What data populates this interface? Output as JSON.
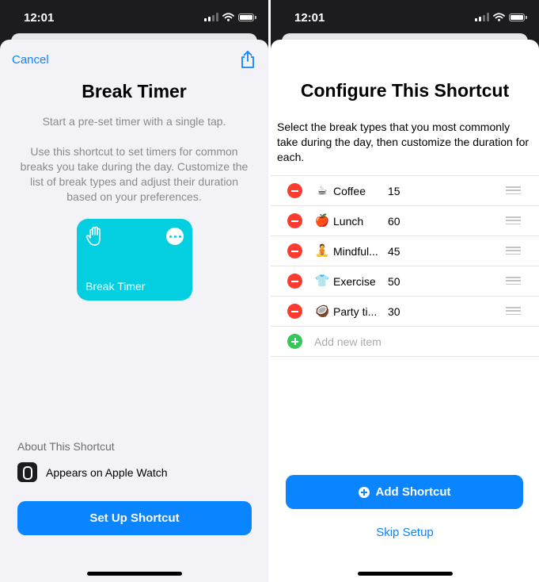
{
  "left": {
    "status_time": "12:01",
    "cancel_label": "Cancel",
    "title": "Break Timer",
    "subtitle": "Start a pre-set timer with a single tap.",
    "description": "Use this shortcut to set timers for common breaks you take during the day. Customize the list of break types and adjust their duration based on your preferences.",
    "tile": {
      "label": "Break Timer",
      "color": "#03cfe0",
      "icon": "raised-hand-icon"
    },
    "about_heading": "About This Shortcut",
    "watch_label": "Appears on Apple Watch",
    "setup_button_label": "Set Up Shortcut"
  },
  "right": {
    "status_time": "12:01",
    "title": "Configure This Shortcut",
    "description": "Select the break types that you most commonly take during the day, then customize the duration for each.",
    "items": [
      {
        "emoji": "☕",
        "name": "Coffee",
        "duration": "15"
      },
      {
        "emoji": "🍎",
        "name": "Lunch",
        "duration": "60"
      },
      {
        "emoji": "🧘",
        "name": "Mindful...",
        "duration": "45"
      },
      {
        "emoji": "👕",
        "name": "Exercise",
        "duration": "50"
      },
      {
        "emoji": "🥥",
        "name": "Party ti...",
        "duration": "30"
      }
    ],
    "add_item_placeholder": "Add new item",
    "add_button_label": "Add Shortcut",
    "skip_label": "Skip Setup"
  },
  "colors": {
    "accent": "#0a84ff",
    "delete": "#ff3b30",
    "add": "#34c759"
  }
}
